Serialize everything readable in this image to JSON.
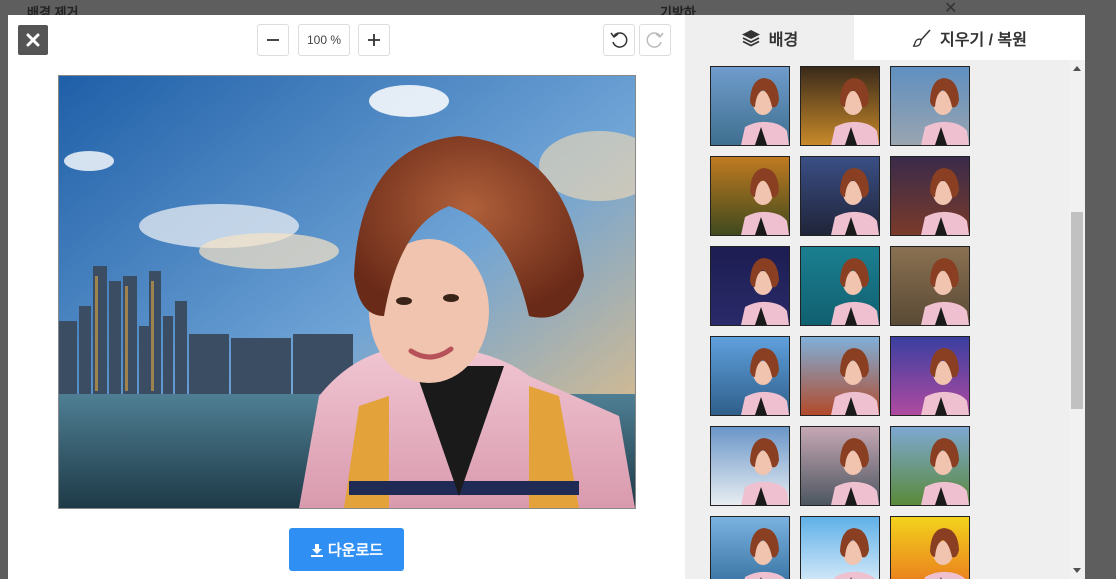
{
  "background_page": {
    "left_label": "배경 제거",
    "right_label": "기방하"
  },
  "toolbar": {
    "zoom_value": "100 %",
    "icons": [
      "close-icon",
      "minus-icon",
      "plus-icon",
      "undo-icon",
      "redo-icon"
    ]
  },
  "tabs": {
    "background": {
      "label": "배경",
      "icon": "layers-icon"
    },
    "erase": {
      "label": "지우기 / 복원",
      "icon": "brush-icon"
    }
  },
  "download": {
    "label": "다운로드",
    "icon": "download-icon"
  },
  "backgrounds": [
    {
      "sky": "#6f9ccc",
      "ground": "#3f6f8f"
    },
    {
      "sky": "#3a2a1a",
      "ground": "#c88a2a"
    },
    {
      "sky": "#5f8fc0",
      "ground": "#9aa5b0"
    },
    {
      "sky": "#c07a20",
      "ground": "#3f4a1e"
    },
    {
      "sky": "#3b4f86",
      "ground": "#1f2438"
    },
    {
      "sky": "#3a2b4a",
      "ground": "#7a3a2a"
    },
    {
      "sky": "#1d1d52",
      "ground": "#2a2a6a"
    },
    {
      "sky": "#1b7f90",
      "ground": "#106070"
    },
    {
      "sky": "#8a7152",
      "ground": "#5a4a35"
    },
    {
      "sky": "#5fa0dd",
      "ground": "#2f5f8a"
    },
    {
      "sky": "#7fb0da",
      "ground": "#b24a2a"
    },
    {
      "sky": "#3a3fa0",
      "ground": "#b04aa0"
    },
    {
      "sky": "#6a96c8",
      "ground": "#e8edf2"
    },
    {
      "sky": "#c6a8b4",
      "ground": "#4c5660"
    },
    {
      "sky": "#7ea8d2",
      "ground": "#5a8a3a"
    },
    {
      "sky": "#7ab2e0",
      "ground": "#2f6a9a"
    },
    {
      "sky": "#5fb0e8",
      "ground": "#eaf4fb"
    },
    {
      "sky": "#f3d21c",
      "ground": "#e8701e"
    }
  ],
  "colors": {
    "accent": "#2f8ff2",
    "panel": "#efefef",
    "close_bg": "#555555"
  }
}
